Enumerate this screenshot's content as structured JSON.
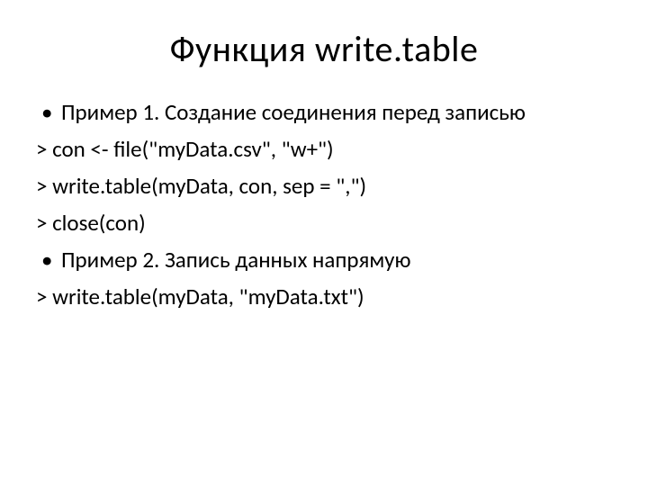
{
  "title": "Функция  write.table",
  "lines": {
    "b1": "Пример 1. Создание соединения перед записью",
    "c1": "> con <- file(\"myData.csv\", \"w+\")",
    "c2": "> write.table(myData, con, sep = \",\")",
    "c3": "> close(con)",
    "b2": "Пример 2. Запись данных напрямую",
    "c4": "> write.table(myData, \"myData.txt\")"
  }
}
